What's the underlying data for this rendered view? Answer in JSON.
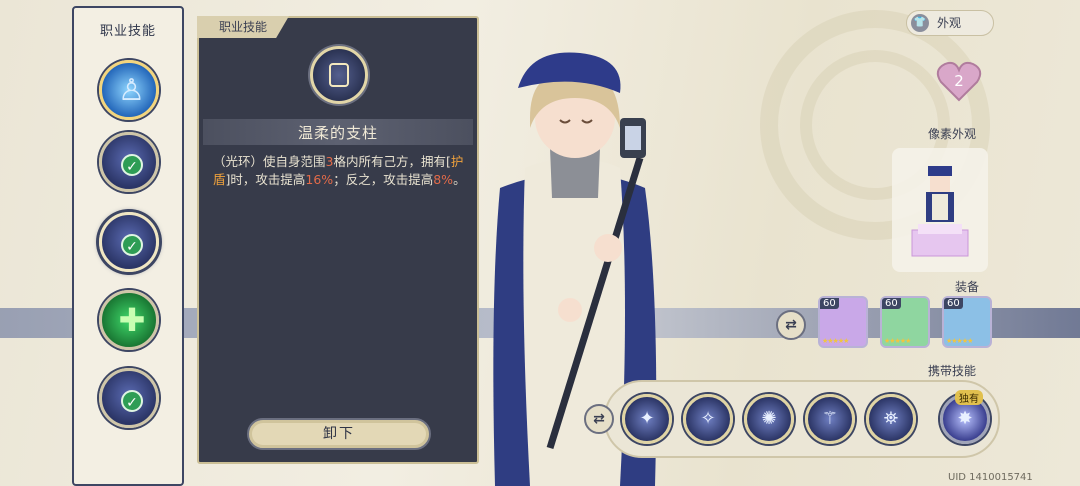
{
  "skill_column": {
    "title": "职业技能",
    "slots": [
      {
        "icon": "figure-aura-icon",
        "equipped": false,
        "selected": false
      },
      {
        "icon": "dna-plus-icon",
        "equipped": true,
        "selected": false
      },
      {
        "icon": "lantern-pillar-icon",
        "equipped": true,
        "selected": true
      },
      {
        "icon": "green-cross-icon",
        "equipped": false,
        "selected": false
      },
      {
        "icon": "light-beam-icon",
        "equipped": true,
        "selected": false
      }
    ]
  },
  "detail": {
    "tag": "职业技能",
    "skill_name": "温柔的支柱",
    "desc_part1": "（光环）使自身范围",
    "desc_range": "3",
    "desc_part2": "格内所有己方，拥有[",
    "desc_shield": "护盾",
    "desc_part3": "]时，攻击提高",
    "desc_pct1": "16%",
    "desc_part4": "；反之，攻击提高",
    "desc_pct2": "8%",
    "desc_part5": "。",
    "unequip_label": "卸下"
  },
  "right": {
    "appearance_label": "外观",
    "heart_count": "2",
    "pixel_appearance_label": "像素外观",
    "equipment_label": "装备",
    "carry_skills_label": "携带技能",
    "exclusive_tag": "独有",
    "equipment": [
      {
        "level": "60",
        "color": "#c9a8e8"
      },
      {
        "level": "60",
        "color": "#8fd6a0"
      },
      {
        "level": "60",
        "color": "#8cc0e6"
      }
    ],
    "carry_skills": [
      {
        "icon": "spear-strike-icon",
        "glyph": "✦"
      },
      {
        "icon": "hand-sparkle-icon",
        "glyph": "✧"
      },
      {
        "icon": "light-pillar-icon",
        "glyph": "✺"
      },
      {
        "icon": "dna-helix-icon",
        "glyph": "⚚"
      },
      {
        "icon": "lantern-pillar-icon",
        "glyph": "⛯"
      },
      {
        "icon": "burst-star-icon",
        "glyph": "✸"
      }
    ]
  },
  "uid": "UID 1410015741"
}
